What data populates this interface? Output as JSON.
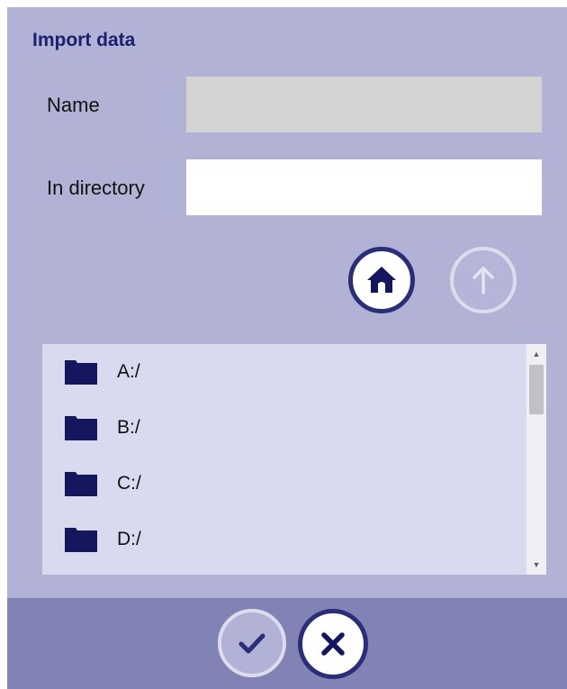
{
  "dialog": {
    "title": "Import data"
  },
  "form": {
    "name_label": "Name",
    "name_value": "",
    "directory_label": "In directory",
    "directory_value": ""
  },
  "navigation": {
    "home_icon": "home-icon",
    "up_icon": "arrow-up-icon"
  },
  "file_list": {
    "items": [
      {
        "label": "A:/",
        "icon": "folder-icon"
      },
      {
        "label": "B:/",
        "icon": "folder-icon"
      },
      {
        "label": "C:/",
        "icon": "folder-icon"
      },
      {
        "label": "D:/",
        "icon": "folder-icon"
      }
    ]
  },
  "footer": {
    "ok_icon": "checkmark-icon",
    "cancel_icon": "close-icon"
  },
  "colors": {
    "dialog_bg": "#b1b2d6",
    "footer_bg": "#8083b3",
    "accent": "#2a2e78",
    "folder": "#14165e",
    "list_bg": "#d9daef"
  }
}
